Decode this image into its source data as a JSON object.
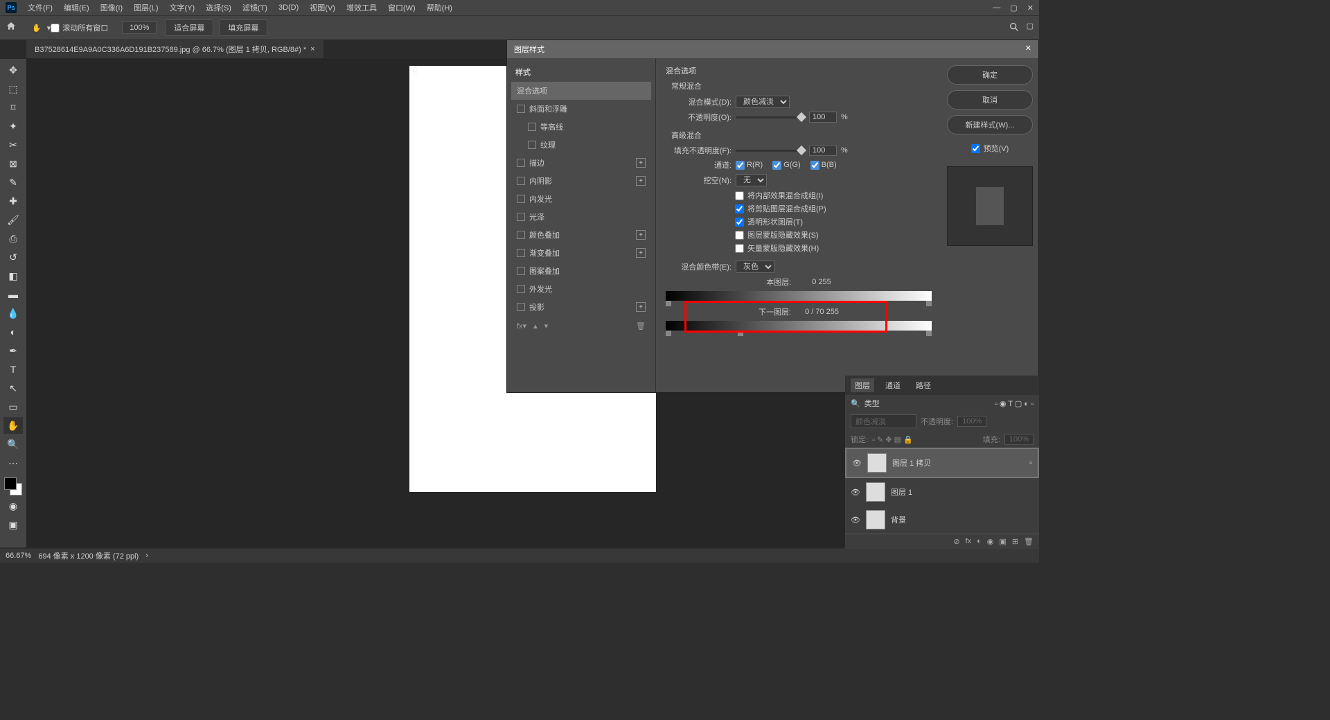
{
  "menu": {
    "items": [
      "文件(F)",
      "编辑(E)",
      "图像(I)",
      "图层(L)",
      "文字(Y)",
      "选择(S)",
      "滤镜(T)",
      "3D(D)",
      "视图(V)",
      "增效工具",
      "窗口(W)",
      "帮助(H)"
    ]
  },
  "options": {
    "scroll_all": "滚动所有窗口",
    "zoom": "100%",
    "fit_screen": "适合屏幕",
    "fill_screen": "填充屏幕"
  },
  "tab": {
    "title": "B37528614E9A9A0C336A6D191B237589.jpg @ 66.7% (图层 1 拷贝, RGB/8#) *"
  },
  "dialog": {
    "title": "图层样式",
    "styles_hdr": "样式",
    "blend_opts": "混合选项",
    "style_items": [
      {
        "label": "斜面和浮雕",
        "indent": false,
        "plus": false
      },
      {
        "label": "等高线",
        "indent": true,
        "plus": false
      },
      {
        "label": "纹理",
        "indent": true,
        "plus": false
      },
      {
        "label": "描边",
        "indent": false,
        "plus": true
      },
      {
        "label": "内阴影",
        "indent": false,
        "plus": true
      },
      {
        "label": "内发光",
        "indent": false,
        "plus": false
      },
      {
        "label": "光泽",
        "indent": false,
        "plus": false
      },
      {
        "label": "颜色叠加",
        "indent": false,
        "plus": true
      },
      {
        "label": "渐变叠加",
        "indent": false,
        "plus": true
      },
      {
        "label": "图案叠加",
        "indent": false,
        "plus": false
      },
      {
        "label": "外发光",
        "indent": false,
        "plus": false
      },
      {
        "label": "投影",
        "indent": false,
        "plus": true
      }
    ],
    "blend_section": "混合选项",
    "normal_blend": "常规混合",
    "blend_mode_lbl": "混合模式(D):",
    "blend_mode_val": "颜色减淡",
    "opacity_lbl": "不透明度(O):",
    "opacity_val": "100",
    "percent": "%",
    "adv_blend": "高级混合",
    "fill_opacity_lbl": "填充不透明度(F):",
    "fill_opacity_val": "100",
    "channels_lbl": "通道:",
    "ch_r": "R(R)",
    "ch_g": "G(G)",
    "ch_b": "B(B)",
    "knockout_lbl": "挖空(N):",
    "knockout_val": "无",
    "adv_checks": [
      {
        "label": "将内部效果混合成组(I)",
        "checked": false
      },
      {
        "label": "将剪贴图层混合成组(P)",
        "checked": true
      },
      {
        "label": "透明形状图层(T)",
        "checked": true
      },
      {
        "label": "图层蒙版隐藏效果(S)",
        "checked": false
      },
      {
        "label": "矢量蒙版隐藏效果(H)",
        "checked": false
      }
    ],
    "blend_if_lbl": "混合颜色带(E):",
    "blend_if_val": "灰色",
    "this_layer": "本图层:",
    "this_vals": "0          255",
    "under_layer": "下一图层:",
    "under_vals": "0  /  70    255",
    "btn_ok": "确定",
    "btn_cancel": "取消",
    "btn_new_style": "新建样式(W)...",
    "preview": "预览(V)"
  },
  "panels": {
    "tabs": [
      "图层",
      "通道",
      "路径"
    ],
    "kind_lbl": "类型",
    "mode_val": "颜色减淡",
    "opacity_lbl": "不透明度:",
    "opacity_val": "100%",
    "lock_lbl": "锁定:",
    "fill_lbl": "填充:",
    "fill_val": "100%",
    "layers": [
      {
        "name": "图层 1 拷贝"
      },
      {
        "name": "图层 1"
      },
      {
        "name": "背景"
      }
    ]
  },
  "status": {
    "zoom": "66.67%",
    "dims": "694 像素 x 1200 像素 (72 ppi)"
  }
}
